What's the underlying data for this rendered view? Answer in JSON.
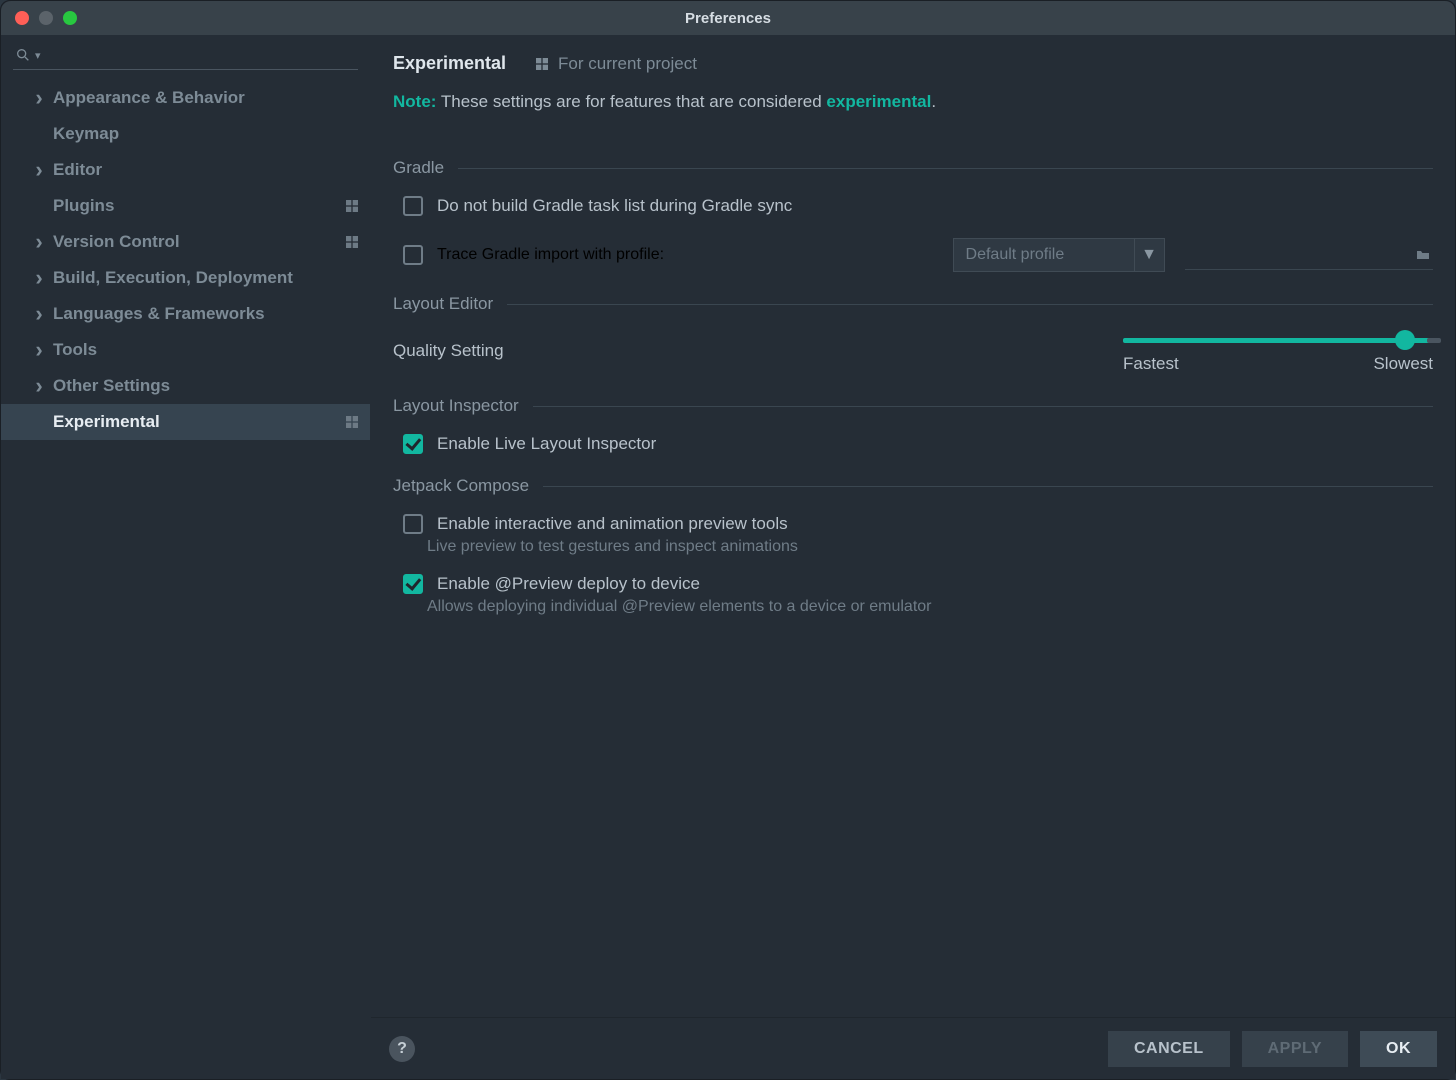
{
  "window": {
    "title": "Preferences"
  },
  "sidebar": {
    "items": [
      {
        "label": "Appearance & Behavior",
        "chevron": true,
        "proj": false
      },
      {
        "label": "Keymap",
        "chevron": false,
        "proj": false
      },
      {
        "label": "Editor",
        "chevron": true,
        "proj": false
      },
      {
        "label": "Plugins",
        "chevron": false,
        "proj": true
      },
      {
        "label": "Version Control",
        "chevron": true,
        "proj": true
      },
      {
        "label": "Build, Execution, Deployment",
        "chevron": true,
        "proj": false
      },
      {
        "label": "Languages & Frameworks",
        "chevron": true,
        "proj": false
      },
      {
        "label": "Tools",
        "chevron": true,
        "proj": false
      },
      {
        "label": "Other Settings",
        "chevron": true,
        "proj": false
      },
      {
        "label": "Experimental",
        "chevron": false,
        "proj": true,
        "selected": true
      }
    ]
  },
  "header": {
    "page_title": "Experimental",
    "for_project": "For current project"
  },
  "note": {
    "prefix": "Note:",
    "text_before": " These settings are for features that are considered ",
    "link": "experimental",
    "text_after": "."
  },
  "sections": {
    "gradle": {
      "title": "Gradle",
      "no_build_label": "Do not build Gradle task list during Gradle sync",
      "no_build_checked": false,
      "trace_label": "Trace Gradle import with profile:",
      "trace_checked": false,
      "profile_value": "Default profile"
    },
    "layout_editor": {
      "title": "Layout Editor",
      "quality_label": "Quality Setting",
      "slider_left": "Fastest",
      "slider_right": "Slowest"
    },
    "layout_inspector": {
      "title": "Layout Inspector",
      "live_label": "Enable Live Layout Inspector",
      "live_checked": true
    },
    "jetpack": {
      "title": "Jetpack Compose",
      "interactive_label": "Enable interactive and animation preview tools",
      "interactive_checked": false,
      "interactive_hint": "Live preview to test gestures and inspect animations",
      "deploy_label": "Enable @Preview deploy to device",
      "deploy_checked": true,
      "deploy_hint": "Allows deploying individual @Preview elements to a device or emulator"
    }
  },
  "footer": {
    "cancel": "CANCEL",
    "apply": "APPLY",
    "ok": "OK"
  }
}
